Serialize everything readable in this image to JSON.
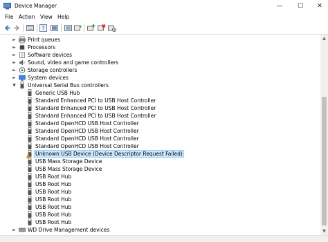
{
  "window": {
    "title": "Device Manager",
    "minimize_glyph": "—",
    "maximize_glyph": "☐",
    "close_glyph": "✕"
  },
  "menu": {
    "file": "File",
    "action": "Action",
    "view": "View",
    "help": "Help"
  },
  "toolbar": {
    "icons": [
      "back-icon",
      "forward-icon",
      "properties-icon",
      "help-icon",
      "scan-icon",
      "update-driver-icon",
      "disable-icon",
      "uninstall-icon"
    ]
  },
  "tree": {
    "categories": [
      {
        "label": "Print queues",
        "icon": "printer-icon",
        "expanded": false
      },
      {
        "label": "Processors",
        "icon": "processor-icon",
        "expanded": false
      },
      {
        "label": "Software devices",
        "icon": "software-icon",
        "expanded": false
      },
      {
        "label": "Sound, video and game controllers",
        "icon": "speaker-icon",
        "expanded": false
      },
      {
        "label": "Storage controllers",
        "icon": "storage-icon",
        "expanded": false
      },
      {
        "label": "System devices",
        "icon": "system-icon",
        "expanded": false
      },
      {
        "label": "Universal Serial Bus controllers",
        "icon": "usb-icon",
        "expanded": true
      }
    ],
    "usb_children": [
      {
        "label": "Generic USB Hub",
        "warning": false
      },
      {
        "label": "Standard Enhanced PCI to USB Host Controller",
        "warning": false
      },
      {
        "label": "Standard Enhanced PCI to USB Host Controller",
        "warning": false
      },
      {
        "label": "Standard Enhanced PCI to USB Host Controller",
        "warning": false
      },
      {
        "label": "Standard OpenHCD USB Host Controller",
        "warning": false
      },
      {
        "label": "Standard OpenHCD USB Host Controller",
        "warning": false
      },
      {
        "label": "Standard OpenHCD USB Host Controller",
        "warning": false
      },
      {
        "label": "Standard OpenHCD USB Host Controller",
        "warning": false
      },
      {
        "label": "Unknown USB Device (Device Descriptor Request Failed)",
        "warning": true
      },
      {
        "label": "USB Mass Storage Device",
        "warning": false
      },
      {
        "label": "USB Mass Storage Device",
        "warning": false
      },
      {
        "label": "USB Root Hub",
        "warning": false
      },
      {
        "label": "USB Root Hub",
        "warning": false
      },
      {
        "label": "USB Root Hub",
        "warning": false
      },
      {
        "label": "USB Root Hub",
        "warning": false
      },
      {
        "label": "USB Root Hub",
        "warning": false
      },
      {
        "label": "USB Root Hub",
        "warning": false
      },
      {
        "label": "USB Root Hub",
        "warning": false
      }
    ],
    "trailing": {
      "label": "WD Drive Management devices",
      "icon": "drive-icon",
      "expanded": false
    }
  },
  "colors": {
    "selection_bg": "#cce8ff",
    "selection_border": "#99d1ff",
    "warning": "#f2c200"
  }
}
